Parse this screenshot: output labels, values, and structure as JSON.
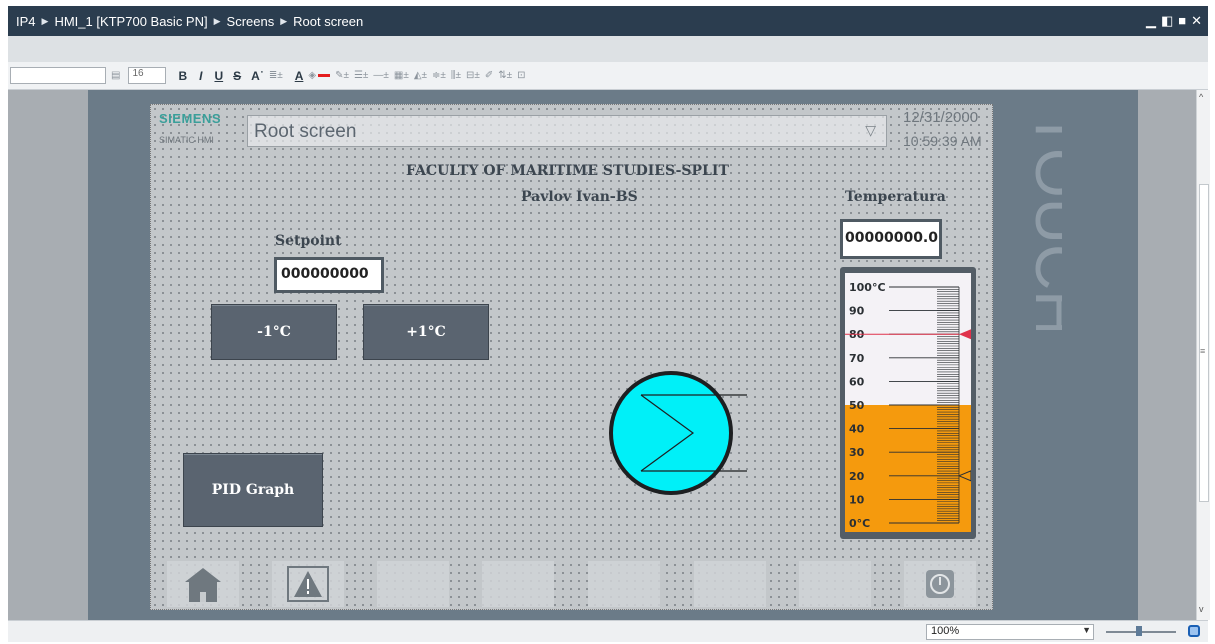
{
  "titlebar": {
    "crumbs": [
      "IP4",
      "HMI_1 [KTP700 Basic PN]",
      "Screens",
      "Root screen"
    ],
    "controls": [
      "minimize-icon",
      "restore-icon",
      "maximize-icon",
      "close-icon"
    ]
  },
  "toolbar": {
    "font_size": "16",
    "bold": "B",
    "italic": "I",
    "underline": "U",
    "strike": "S",
    "font_color": "A",
    "accent_colors": {
      "font": "#e41d1d",
      "fill": "#1e56c9",
      "line": "#000000"
    }
  },
  "hmi": {
    "brand": "SIEMENS",
    "brand_sub": "SIMATIC HMI",
    "screen_name": "Root screen",
    "date": "12/31/2000",
    "time": "10:59:39 AM",
    "title": "FACULTY OF MARITIME STUDIES-SPLIT",
    "subtitle": "Pavlov Ivan-BS",
    "temperature_label": "Temperatura",
    "temperature_value": "00000000.0",
    "setpoint_label": "Setpoint",
    "setpoint_value": "000000000",
    "btn_minus": "-1°C",
    "btn_plus": "+1°C",
    "btn_pid": "PID Graph",
    "device_watermark": "TOUCH",
    "bar": {
      "min": 0,
      "max": 100,
      "value": 50,
      "upper_limit": 80,
      "lower_limit": 20,
      "tick_labels": [
        "100°C",
        "90",
        "80",
        "70",
        "60",
        "50",
        "40",
        "30",
        "20",
        "10",
        "0°C"
      ],
      "fill_color": "#f59a0d"
    },
    "function_keys": [
      "home-icon",
      "alarm-icon",
      "",
      "",
      "",
      "",
      "",
      "shutdown-icon"
    ]
  },
  "status": {
    "zoom": "100%"
  }
}
